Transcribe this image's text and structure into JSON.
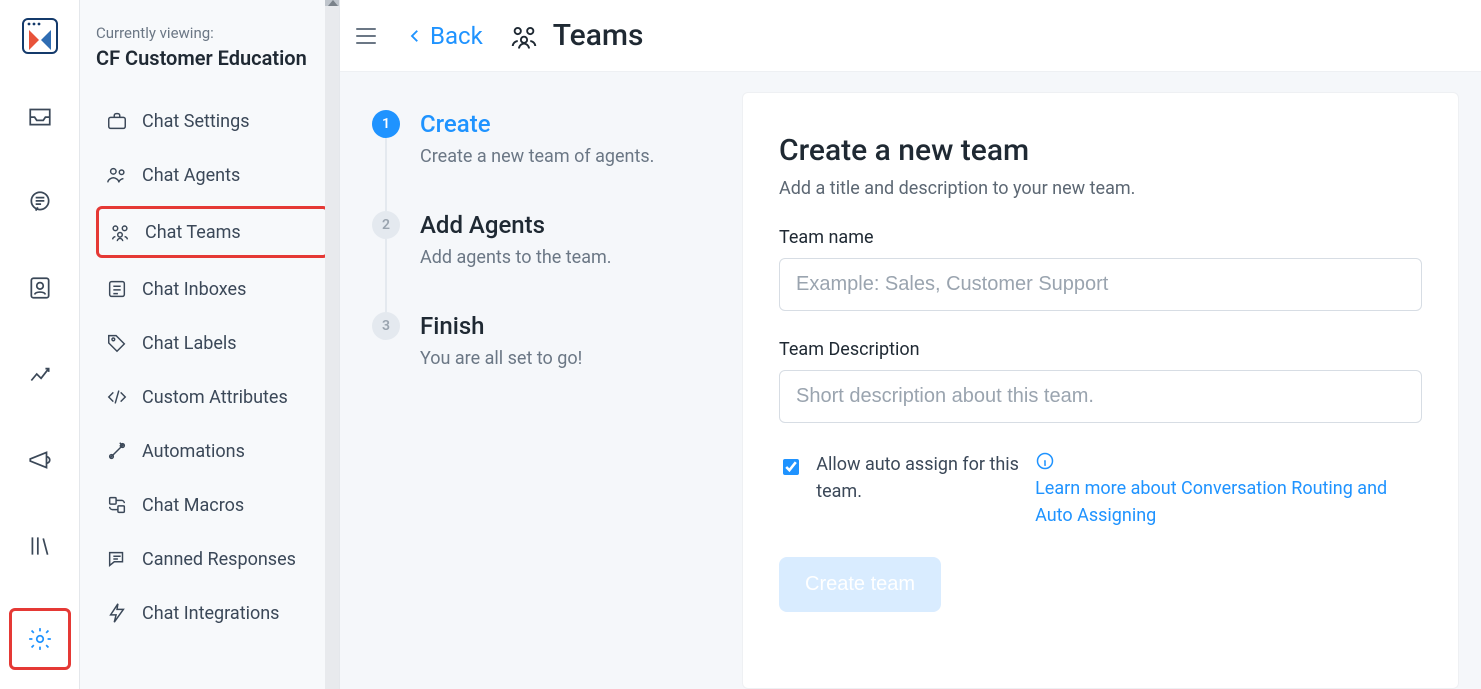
{
  "context": {
    "label": "Currently viewing:",
    "value": "CF Customer Education"
  },
  "sidebar": {
    "items": [
      {
        "label": "Chat Settings",
        "icon": "briefcase-icon"
      },
      {
        "label": "Chat Agents",
        "icon": "agents-icon"
      },
      {
        "label": "Chat Teams",
        "icon": "team-icon",
        "highlighted": true
      },
      {
        "label": "Chat Inboxes",
        "icon": "inbox-list-icon"
      },
      {
        "label": "Chat Labels",
        "icon": "tag-icon"
      },
      {
        "label": "Custom Attributes",
        "icon": "code-icon"
      },
      {
        "label": "Automations",
        "icon": "automation-icon"
      },
      {
        "label": "Chat Macros",
        "icon": "macro-icon"
      },
      {
        "label": "Canned Responses",
        "icon": "canned-icon"
      },
      {
        "label": "Chat Integrations",
        "icon": "bolt-icon"
      }
    ]
  },
  "topbar": {
    "back": "Back",
    "title": "Teams"
  },
  "stepper": [
    {
      "title": "Create",
      "desc": "Create a new team of agents.",
      "active": true
    },
    {
      "title": "Add Agents",
      "desc": "Add agents to the team.",
      "active": false
    },
    {
      "title": "Finish",
      "desc": "You are all set to go!",
      "active": false
    }
  ],
  "form": {
    "heading": "Create a new team",
    "sub": "Add a title and description to your new team.",
    "name_label": "Team name",
    "name_placeholder": "Example: Sales, Customer Support",
    "desc_label": "Team Description",
    "desc_placeholder": "Short description about this team.",
    "checkbox_label": "Allow auto assign for this team.",
    "checkbox_checked": true,
    "help_link": "Learn more about Conversation Routing and Auto Assigning",
    "submit": "Create team"
  }
}
